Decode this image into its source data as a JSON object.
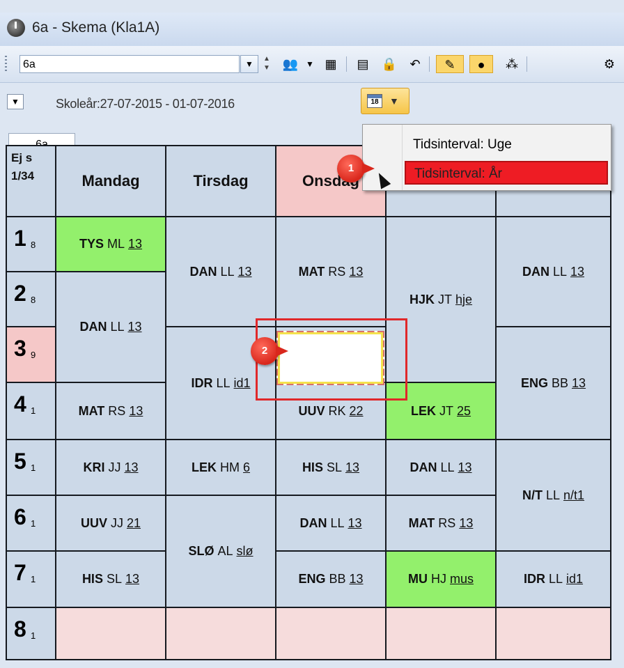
{
  "window": {
    "title": "6a -  Skema  (Kla1A)"
  },
  "toolbar": {
    "class_value": "6a",
    "icons": [
      "combo-dropdown-icon",
      "spinner-icon",
      "people-icon",
      "grid-icon",
      "export-icon",
      "lock-icon",
      "undo-icon",
      "brush-icon",
      "pin-icon",
      "share-icon",
      "gear-icon"
    ]
  },
  "header": {
    "school_year": "Skoleår:27-07-2015 - 01-07-2016",
    "tab": "6a",
    "calendar_day": "18"
  },
  "menu": {
    "items": [
      "Tidsinterval: Uge",
      "Tidsinterval: År"
    ],
    "selected": "Tidsinterval: År"
  },
  "callouts": [
    "1",
    "2"
  ],
  "schedule": {
    "corner": [
      "Ej s",
      "1/34"
    ],
    "days": [
      "Mandag",
      "Tirsdag",
      "Onsdag",
      "Torsdag",
      "Fredag"
    ],
    "periods": [
      {
        "num": "1",
        "sub": "8"
      },
      {
        "num": "2",
        "sub": "8"
      },
      {
        "num": "3",
        "sub": "9"
      },
      {
        "num": "4",
        "sub": "1"
      },
      {
        "num": "5",
        "sub": "1"
      },
      {
        "num": "6",
        "sub": "1"
      },
      {
        "num": "7",
        "sub": "1"
      },
      {
        "num": "8",
        "sub": "1"
      }
    ],
    "lessons": {
      "mon_1": {
        "subj": "TYS",
        "teacher": "ML",
        "room": "13"
      },
      "mon_23": {
        "subj": "DAN",
        "teacher": "LL",
        "room": "13"
      },
      "mon_4": {
        "subj": "MAT",
        "teacher": "RS",
        "room": "13"
      },
      "mon_5": {
        "subj": "KRI",
        "teacher": "JJ",
        "room": "13"
      },
      "mon_6": {
        "subj": "UUV",
        "teacher": "JJ",
        "room": "21"
      },
      "mon_7": {
        "subj": "HIS",
        "teacher": "SL",
        "room": "13"
      },
      "tue_12": {
        "subj": "DAN",
        "teacher": "LL",
        "room": "13"
      },
      "tue_34": {
        "subj": "IDR",
        "teacher": "LL",
        "room": "id1"
      },
      "tue_5": {
        "subj": "LEK",
        "teacher": "HM",
        "room": "6"
      },
      "tue_67": {
        "subj": "SLØ",
        "teacher": "AL",
        "room": "slø"
      },
      "wed_12": {
        "subj": "MAT",
        "teacher": "RS",
        "room": "13"
      },
      "wed_4": {
        "subj": "UUV",
        "teacher": "RK",
        "room": "22"
      },
      "wed_5": {
        "subj": "HIS",
        "teacher": "SL",
        "room": "13"
      },
      "wed_6": {
        "subj": "DAN",
        "teacher": "LL",
        "room": "13"
      },
      "wed_7": {
        "subj": "ENG",
        "teacher": "BB",
        "room": "13"
      },
      "thu_13": {
        "subj": "HJK",
        "teacher": "JT",
        "room": "hje"
      },
      "thu_4": {
        "subj": "LEK",
        "teacher": "JT",
        "room": "25"
      },
      "thu_5": {
        "subj": "DAN",
        "teacher": "LL",
        "room": "13"
      },
      "thu_6": {
        "subj": "MAT",
        "teacher": "RS",
        "room": "13"
      },
      "thu_7": {
        "subj": "MU",
        "teacher": "HJ",
        "room": "mus"
      },
      "fri_12": {
        "subj": "DAN",
        "teacher": "LL",
        "room": "13"
      },
      "fri_34": {
        "subj": "ENG",
        "teacher": "BB",
        "room": "13"
      },
      "fri_56": {
        "subj": "N/T",
        "teacher": "LL",
        "room": "n/t1"
      },
      "fri_7": {
        "subj": "IDR",
        "teacher": "LL",
        "room": "id1"
      }
    }
  }
}
